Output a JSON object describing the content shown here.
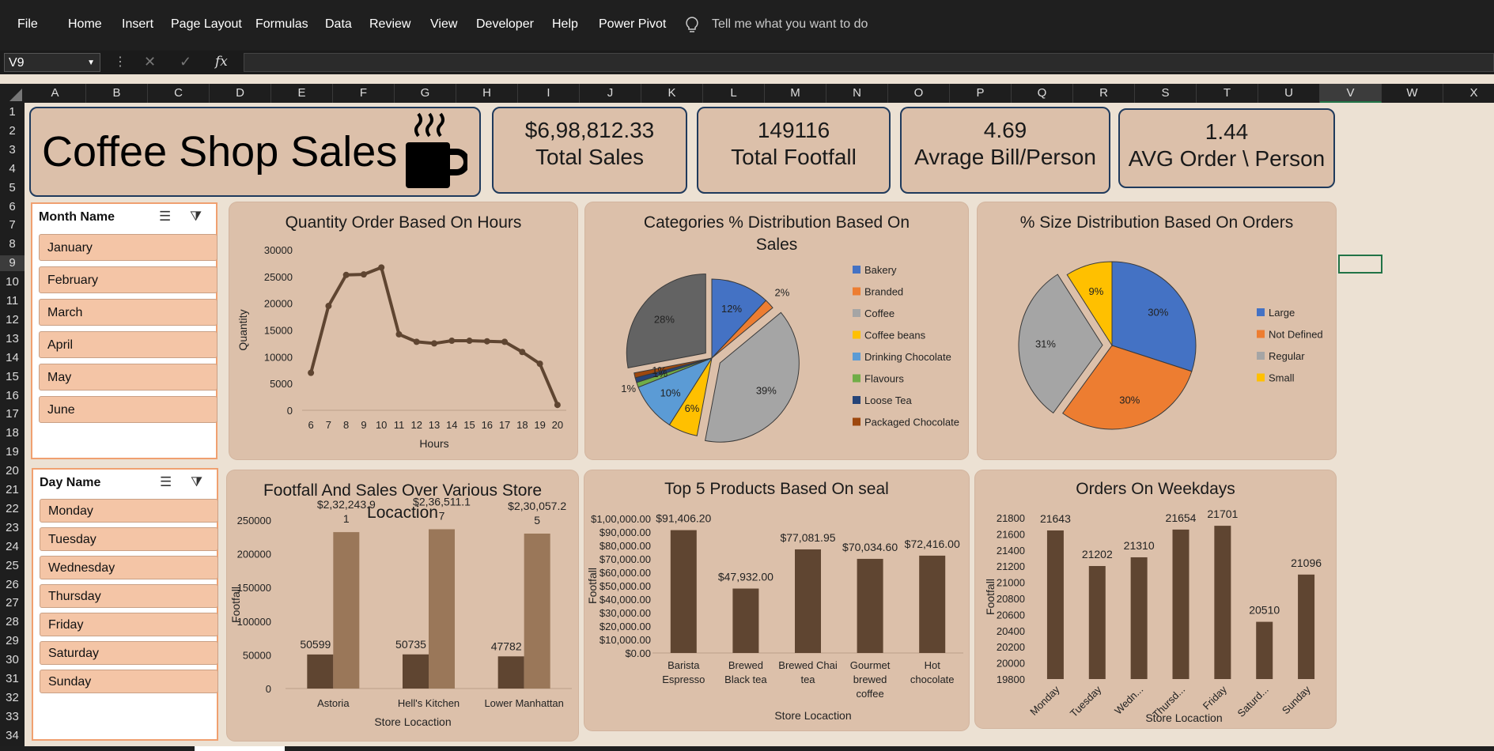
{
  "ribbon": {
    "menu": [
      "File",
      "Home",
      "Insert",
      "Page Layout",
      "Formulas",
      "Data",
      "Review",
      "View",
      "Developer",
      "Help",
      "Power Pivot"
    ],
    "tell_me": "Tell me what you want to do"
  },
  "formula_bar": {
    "name_box": "V9",
    "fx": "fx",
    "value": ""
  },
  "columns": [
    "A",
    "B",
    "C",
    "D",
    "E",
    "F",
    "G",
    "H",
    "I",
    "J",
    "K",
    "L",
    "M",
    "N",
    "O",
    "P",
    "Q",
    "R",
    "S",
    "T",
    "U",
    "V",
    "W",
    "X"
  ],
  "rows": [
    "1",
    "2",
    "3",
    "4",
    "5",
    "6",
    "7",
    "8",
    "9",
    "10",
    "11",
    "12",
    "13",
    "14",
    "15",
    "16",
    "17",
    "18",
    "19",
    "20",
    "21",
    "22",
    "23",
    "24",
    "25",
    "26",
    "27",
    "28",
    "29",
    "30",
    "31",
    "32",
    "33",
    "34"
  ],
  "title": "Coffee Shop Sales",
  "kpis": [
    {
      "value": "$6,98,812.33",
      "label": "Total Sales"
    },
    {
      "value": "149116",
      "label": "Total Footfall"
    },
    {
      "value": "4.69",
      "label": "Avrage Bill/Person"
    },
    {
      "value": "1.44",
      "label": "AVG Order \\ Person"
    }
  ],
  "month_slicer": {
    "title": "Month Name",
    "items": [
      "January",
      "February",
      "March",
      "April",
      "May",
      "June"
    ]
  },
  "day_slicer": {
    "title": "Day Name",
    "items": [
      "Monday",
      "Tuesday",
      "Wednesday",
      "Thursday",
      "Friday",
      "Saturday",
      "Sunday"
    ]
  },
  "colors": {
    "line": "#5f4531",
    "bar_dark": "#5f4531",
    "bar_light": "#9a7759",
    "panel": "#dcc0aa",
    "sheet_bg": "#ece1d3"
  },
  "chart_data": [
    {
      "type": "line",
      "title": "Quantity Order Based On Hours",
      "xlabel": "Hours",
      "ylabel": "Quantity",
      "x": [
        "6",
        "7",
        "8",
        "9",
        "10",
        "11",
        "12",
        "13",
        "14",
        "15",
        "16",
        "17",
        "18",
        "19",
        "20"
      ],
      "values": [
        7000,
        19500,
        25300,
        25400,
        26700,
        14200,
        12800,
        12500,
        13000,
        13000,
        12900,
        12800,
        10900,
        8700,
        1000
      ],
      "yticks": [
        "0",
        "5000",
        "10000",
        "15000",
        "20000",
        "25000",
        "30000"
      ],
      "ylim": [
        0,
        30000
      ]
    },
    {
      "type": "pie",
      "title": "Categories % Distribution Based On Sales",
      "legend": [
        "Bakery",
        "Branded",
        "Coffee",
        "Coffee beans",
        "Drinking Chocolate",
        "Flavours",
        "Loose Tea",
        "Packaged Chocolate"
      ],
      "legend_placement": "right",
      "slices": [
        {
          "name": "Bakery",
          "label": "12%",
          "value": 12,
          "color": "#4472c4"
        },
        {
          "name": "Branded",
          "label": "2%",
          "value": 2,
          "color": "#ed7d31"
        },
        {
          "name": "Coffee",
          "label": "39%",
          "value": 39,
          "color": "#a5a5a5"
        },
        {
          "name": "Coffee beans",
          "label": "6%",
          "value": 6,
          "color": "#ffc000"
        },
        {
          "name": "Drinking Chocolate",
          "label": "10%",
          "value": 10,
          "color": "#5b9bd5"
        },
        {
          "name": "Flavours",
          "label": "1%",
          "value": 1,
          "color": "#70ad47"
        },
        {
          "name": "Loose Tea",
          "label": "1%",
          "value": 1,
          "color": "#264478"
        },
        {
          "name": "Packaged Chocolate",
          "label": "1%",
          "value": 1,
          "color": "#9e480e"
        },
        {
          "name": "",
          "label": "28%",
          "value": 28,
          "color": "#636363"
        }
      ]
    },
    {
      "type": "pie",
      "title": "% Size Distribution Based On Orders",
      "legend": [
        "Large",
        "Not Defined",
        "Regular",
        "Small"
      ],
      "legend_placement": "right",
      "slices": [
        {
          "name": "Large",
          "label": "30%",
          "value": 30,
          "color": "#4472c4"
        },
        {
          "name": "Not Defined",
          "label": "30%",
          "value": 30,
          "color": "#ed7d31"
        },
        {
          "name": "Regular",
          "label": "31%",
          "value": 31,
          "color": "#a5a5a5"
        },
        {
          "name": "Small",
          "label": "9%",
          "value": 9,
          "color": "#ffc000"
        }
      ]
    },
    {
      "type": "bar",
      "title": "Footfall And Sales Over Various Store Locaction",
      "xlabel": "Store Locaction",
      "ylabel": "Footfall",
      "categories": [
        "Astoria",
        "Hell's Kitchen",
        "Lower Manhattan"
      ],
      "series": [
        {
          "values": [
            50599,
            50735,
            47782
          ],
          "labels": [
            "50599",
            "50735",
            "47782"
          ]
        },
        {
          "values": [
            232243.91,
            236511.17,
            230057.25
          ],
          "labels": [
            "$2,32,243.9\n1",
            "$2,36,511.1\n7",
            "$2,30,057.2\n5"
          ]
        }
      ],
      "yticks": [
        "0",
        "50000",
        "100000",
        "150000",
        "200000",
        "250000"
      ],
      "ylim": [
        0,
        250000
      ]
    },
    {
      "type": "bar",
      "title": "Top 5 Products Based On seal",
      "xlabel": "Store Locaction",
      "ylabel": "Footfall",
      "categories": [
        "Barista\nEspresso",
        "Brewed\nBlack tea",
        "Brewed Chai\ntea",
        "Gourmet\nbrewed\ncoffee",
        "Hot\nchocolate"
      ],
      "values": [
        91406.2,
        47932.0,
        77081.95,
        70034.6,
        72416.0
      ],
      "labels": [
        "$91,406.20",
        "$47,932.00",
        "$77,081.95",
        "$70,034.60",
        "$72,416.00"
      ],
      "yticks": [
        "$0.00",
        "$10,000.00",
        "$20,000.00",
        "$30,000.00",
        "$40,000.00",
        "$50,000.00",
        "$60,000.00",
        "$70,000.00",
        "$80,000.00",
        "$90,000.00",
        "$1,00,000.00"
      ],
      "ylim": [
        0,
        100000
      ]
    },
    {
      "type": "bar",
      "title": "Orders On Weekdays",
      "xlabel": "Store Locaction",
      "ylabel": "Footfall",
      "categories": [
        "Monday",
        "Tuesday",
        "Wedn...",
        "Thursd...",
        "Friday",
        "Saturd...",
        "Sunday"
      ],
      "values": [
        21643,
        21202,
        21310,
        21654,
        21701,
        20510,
        21096
      ],
      "yticks": [
        "19800",
        "20000",
        "20200",
        "20400",
        "20600",
        "20800",
        "21000",
        "21200",
        "21400",
        "21600",
        "21800"
      ],
      "ylim": [
        19800,
        21800
      ]
    }
  ]
}
